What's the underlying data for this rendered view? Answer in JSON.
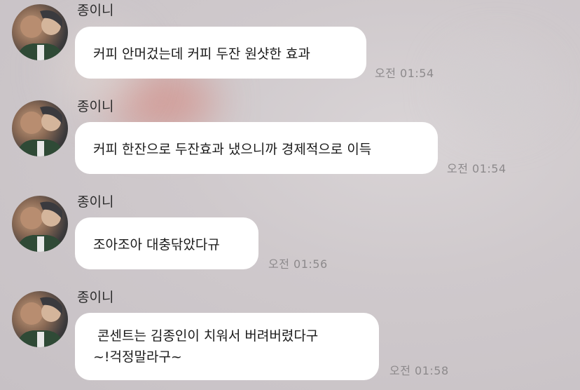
{
  "messages": [
    {
      "sender": "종이니",
      "lines": [
        "커피 안머겄는데 커피 두잔 원샷한 효과"
      ],
      "time": "오전 01:54"
    },
    {
      "sender": "종이니",
      "lines": [
        "커피 한잔으로 두잔효과 냈으니까 경제적으로 이득"
      ],
      "time": "오전 01:54"
    },
    {
      "sender": "종이니",
      "lines": [
        "조아조아 대충닦았다규"
      ],
      "time": "오전 01:56"
    },
    {
      "sender": "종이니",
      "lines": [
        "콘센트는 김종인이 치워서 버려버렸다구",
        "~!걱정말라구~"
      ],
      "time": "오전 01:58"
    }
  ],
  "colors": {
    "bubble": "#ffffff",
    "background": "#cfc9cc",
    "time_text": "#8d8a8c"
  },
  "icons": {
    "avatar": "profile-photo-avatar"
  }
}
